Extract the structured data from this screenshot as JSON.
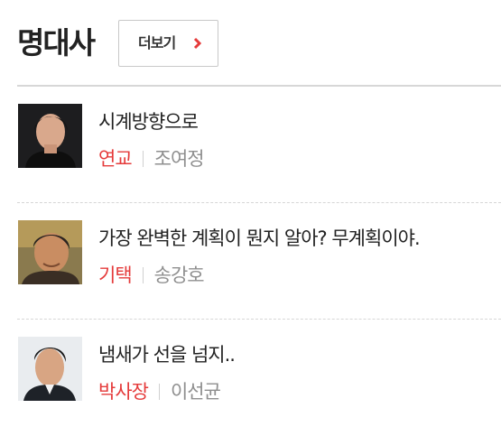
{
  "section": {
    "title": "명대사",
    "more_label": "더보기",
    "more_icon": "chevron-right-icon",
    "accent_color": "#e53b3b"
  },
  "quotes": [
    {
      "text": "시계방향으로",
      "role": "연교",
      "actor": "조여정"
    },
    {
      "text": "가장 완벽한 계획이 뭔지 알아? 무계획이야.",
      "role": "기택",
      "actor": "송강호"
    },
    {
      "text": "냄새가 선을 넘지..",
      "role": "박사장",
      "actor": "이선균"
    }
  ]
}
